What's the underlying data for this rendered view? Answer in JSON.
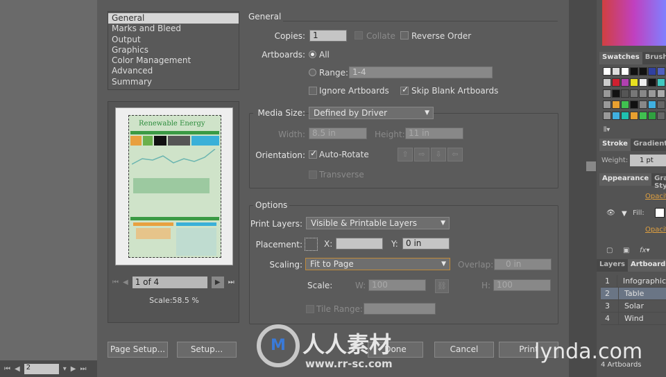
{
  "left_app": {
    "page_value": "2"
  },
  "dialog": {
    "categories": [
      {
        "label": "General",
        "selected": true
      },
      {
        "label": "Marks and Bleed"
      },
      {
        "label": "Output"
      },
      {
        "label": "Graphics"
      },
      {
        "label": "Color Management"
      },
      {
        "label": "Advanced"
      },
      {
        "label": "Summary"
      }
    ],
    "preview": {
      "page_field": "1 of 4",
      "scale": "Scale:58.5 %",
      "thumbnail_title": "Renewable Energy"
    },
    "general": {
      "title": "General",
      "copies_label": "Copies:",
      "copies_value": "1",
      "collate_label": "Collate",
      "collate_checked": false,
      "reverse_label": "Reverse Order",
      "reverse_checked": false,
      "artboards_label": "Artboards:",
      "all_label": "All",
      "all_selected": true,
      "range_label": "Range:",
      "range_value": "1-4",
      "ignore_label": "Ignore Artboards",
      "ignore_checked": false,
      "skip_label": "Skip Blank Artboards",
      "skip_checked": true
    },
    "media": {
      "media_size_label": "Media Size:",
      "media_size_value": "Defined by Driver",
      "width_label": "Width:",
      "width_value": "8.5 in",
      "height_label": "Height:",
      "height_value": "11 in",
      "orientation_label": "Orientation:",
      "autorotate_label": "Auto-Rotate",
      "autorotate_checked": true,
      "transverse_label": "Transverse",
      "transverse_checked": false
    },
    "options": {
      "title": "Options",
      "print_layers_label": "Print Layers:",
      "print_layers_value": "Visible & Printable Layers",
      "placement_label": "Placement:",
      "x_label": "X:",
      "x_value": "",
      "y_label": "Y:",
      "y_value": "0 in",
      "scaling_label": "Scaling:",
      "scaling_value": "Fit to Page",
      "overlap_label": "Overlap:",
      "overlap_value": "0 in",
      "scale_label": "Scale:",
      "w_label": "W:",
      "w_value": "100",
      "h_label": "H:",
      "h_value": "100",
      "tile_label": "Tile Range:",
      "tile_value": ""
    },
    "buttons": {
      "page_setup": "Page Setup...",
      "setup": "Setup...",
      "done": "Done",
      "cancel": "Cancel",
      "print": "Print"
    }
  },
  "right_panel": {
    "swatches_tabs": [
      "Swatches",
      "Brushes"
    ],
    "stroke_tabs": [
      "Stroke",
      "Gradient"
    ],
    "weight_label": "Weight:",
    "weight_value": "1 pt",
    "appearance_tabs": [
      "Appearance",
      "Graphic Styles"
    ],
    "opacity_label": "Opacity",
    "fill_label": "Fill:",
    "layers_tabs": [
      "Layers",
      "Artboards"
    ],
    "artboards": [
      {
        "num": "1",
        "name": "Infographic"
      },
      {
        "num": "2",
        "name": "Table",
        "selected": true
      },
      {
        "num": "3",
        "name": "Solar"
      },
      {
        "num": "4",
        "name": "Wind"
      }
    ],
    "artboard_count": "4 Artboards",
    "accent_color": "#e0a040"
  },
  "watermarks": {
    "rr_logo": "人人素材",
    "rr_url": "www.rr-sc.com",
    "lynda": "lynda.com"
  }
}
